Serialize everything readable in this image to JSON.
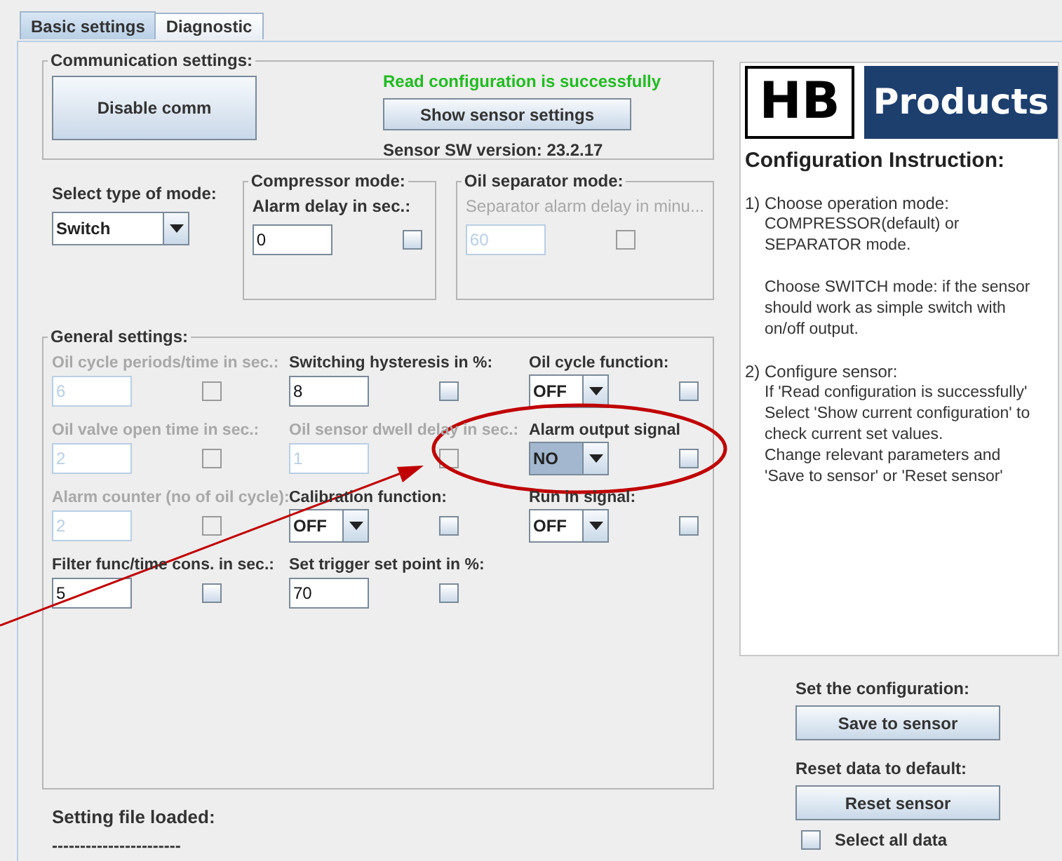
{
  "tabs": [
    {
      "label": "Basic settings",
      "selected": true
    },
    {
      "label": "Diagnostic",
      "selected": false
    }
  ],
  "communication": {
    "title": "Communication settings:",
    "disable_button": "Disable comm",
    "status": "Read configuration is successfully",
    "show_button": "Show sensor settings",
    "version": "Sensor SW version: 23.2.17"
  },
  "mode": {
    "label": "Select type of mode:",
    "value": "Switch"
  },
  "mode_groups": [
    {
      "title": "Compressor mode:",
      "label": "Alarm delay in sec.:",
      "value": "0",
      "disabled": false,
      "checked": false
    },
    {
      "title": "Oil separator mode:",
      "label": "Separator alarm delay in minu...",
      "value": "60",
      "disabled": true,
      "checked": false
    }
  ],
  "general": {
    "title": "General settings:",
    "fields": [
      {
        "kind": "text",
        "label": "Oil cycle periods/time in sec.:",
        "value": "6",
        "disabled": true,
        "checked": false
      },
      {
        "kind": "text",
        "label": "Switching hysteresis in %:",
        "value": "8",
        "disabled": false,
        "checked": false
      },
      {
        "kind": "select",
        "label": "Oil cycle function:",
        "value": "OFF",
        "disabled": false,
        "focused": false,
        "checked": false
      },
      {
        "kind": "text",
        "label": "Oil valve open time in sec.:",
        "value": "2",
        "disabled": true,
        "checked": false
      },
      {
        "kind": "text",
        "label": "Oil sensor dwell delay in sec.:",
        "value": "1",
        "disabled": true,
        "checked": false
      },
      {
        "kind": "select",
        "label": "Alarm output signal",
        "value": "NO",
        "disabled": false,
        "focused": true,
        "checked": false
      },
      {
        "kind": "text",
        "label": "Alarm counter (no of oil cycle):",
        "value": "2",
        "disabled": true,
        "checked": false
      },
      {
        "kind": "select",
        "label": "Calibration function:",
        "value": "OFF",
        "disabled": false,
        "focused": false,
        "checked": false
      },
      {
        "kind": "select",
        "label": "Run in signal:",
        "value": "OFF",
        "disabled": false,
        "focused": false,
        "checked": false
      },
      {
        "kind": "text",
        "label": "Filter func/time cons. in sec.:",
        "value": "5",
        "disabled": false,
        "checked": false
      },
      {
        "kind": "text",
        "label": "Set trigger set point in %:",
        "value": "70",
        "disabled": false,
        "checked": false
      }
    ]
  },
  "file": {
    "label": "Setting file loaded:",
    "value": "-----------------------"
  },
  "instructions": {
    "logo_left": "HB",
    "logo_right": "Products",
    "heading": "Configuration Instruction:",
    "blocks": [
      {
        "head": "1) Choose operation mode:",
        "lines": [
          "COMPRESSOR(default) or",
          "SEPARATOR mode."
        ]
      },
      {
        "lines": [
          "Choose SWITCH mode: if the sensor",
          "should work as simple switch with",
          "on/off output."
        ]
      },
      {
        "head": "2) Configure sensor:",
        "lines": [
          "If 'Read configuration is successfully'",
          "Select 'Show current configuration' to",
          "check current set values.",
          "Change relevant parameters and",
          "'Save to sensor' or 'Reset sensor'"
        ]
      }
    ]
  },
  "actions": {
    "save_label": "Set the configuration:",
    "save_button": "Save to sensor",
    "reset_label": "Reset data to default:",
    "reset_button": "Reset sensor",
    "select_all": {
      "label": "Select all data",
      "checked": false
    }
  }
}
